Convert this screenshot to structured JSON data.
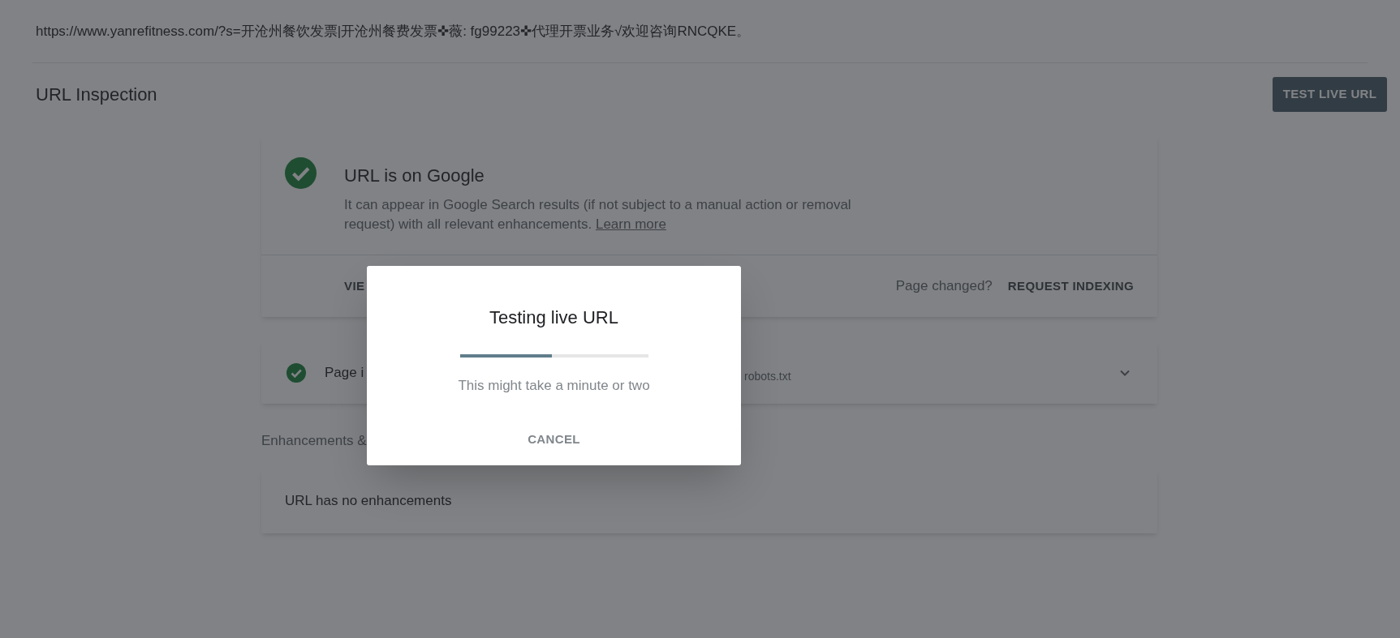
{
  "address": {
    "url": "https://www.yanrefitness.com/?s=开沧州餐饮发票|开沧州餐费发票✜薇: fg99223✜代理开票业务√欢迎咨询RNCQKE。"
  },
  "header": {
    "title": "URL Inspection",
    "button": "TEST LIVE URL"
  },
  "status_card": {
    "title": "URL is on Google",
    "description": "It can appear in Google Search results (if not subject to a manual action or removal request) with all relevant enhancements.",
    "link": "Learn more",
    "left_action": "VIE",
    "prompt": "Page changed?",
    "action": "REQUEST INDEXING"
  },
  "indexing_card": {
    "label": "Page i",
    "detail": "robots.txt",
    "expanded": false
  },
  "enhancements": {
    "heading": "Enhancements &",
    "message": "URL has no enhancements"
  },
  "dialog": {
    "title": "Testing live URL",
    "level": 0.49,
    "message": "This might take a minute or two",
    "button": "CANCEL"
  }
}
